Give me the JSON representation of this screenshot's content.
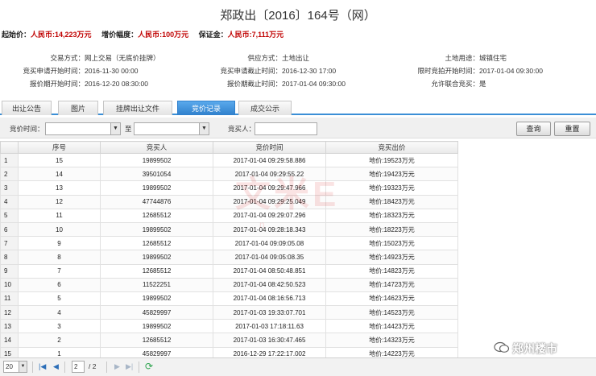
{
  "title": "郑政出〔2016〕164号（网）",
  "summary": [
    {
      "label": "起始价：",
      "value": "人民币:14,223万元"
    },
    {
      "label": "增价幅度：",
      "value": "人民币:100万元"
    },
    {
      "label": "保证金：",
      "value": "人民币:7,111万元"
    }
  ],
  "info": {
    "trade_mode_label": "交易方式：",
    "trade_mode": "网上交易（无底价挂牌）",
    "supply_label": "供应方式：",
    "supply": "土地出让",
    "land_use_label": "土地用途：",
    "land_use": "城镇住宅",
    "apply_start_label": "竞买申请开始时间：",
    "apply_start": "2016-11-30 00:00",
    "apply_end_label": "竞买申请截止时间：",
    "apply_end": "2016-12-30 17:00",
    "timed_start_label": "限时竞拍开始时间：",
    "timed_start": "2017-01-04 09:30:00",
    "quote_start_label": "报价期开始时间：",
    "quote_start": "2016-12-20 08:30:00",
    "quote_end_label": "报价期截止时间：",
    "quote_end": "2017-01-04 09:30:00",
    "joint_label": "允许联合竞买：",
    "joint": "是"
  },
  "tabs": [
    "出让公告",
    "图片",
    "挂牌出让文件",
    "竞价记录",
    "成交公示"
  ],
  "active_tab": 3,
  "filter": {
    "time_label": "竞价时间：",
    "to_label": "至",
    "bidder_label": "竞买人：",
    "query_button": "查询",
    "reset_button": "重置"
  },
  "table": {
    "headers": [
      "序号",
      "竞买人",
      "竞价时间",
      "竞买出价"
    ],
    "rows": [
      [
        "1",
        "15",
        "19899502",
        "2017-01-04 09:29:58.886",
        "地价:19523万元"
      ],
      [
        "2",
        "14",
        "39501054",
        "2017-01-04 09:29:55.22",
        "地价:19423万元"
      ],
      [
        "3",
        "13",
        "19899502",
        "2017-01-04 09:29:47.966",
        "地价:19323万元"
      ],
      [
        "4",
        "12",
        "47744876",
        "2017-01-04 09:29:25.049",
        "地价:18423万元"
      ],
      [
        "5",
        "11",
        "12685512",
        "2017-01-04 09:29:07.296",
        "地价:18323万元"
      ],
      [
        "6",
        "10",
        "19899502",
        "2017-01-04 09:28:18.343",
        "地价:18223万元"
      ],
      [
        "7",
        "9",
        "12685512",
        "2017-01-04 09:09:05.08",
        "地价:15023万元"
      ],
      [
        "8",
        "8",
        "19899502",
        "2017-01-04 09:05:08.35",
        "地价:14923万元"
      ],
      [
        "9",
        "7",
        "12685512",
        "2017-01-04 08:50:48.851",
        "地价:14823万元"
      ],
      [
        "10",
        "6",
        "11522251",
        "2017-01-04 08:42:50.523",
        "地价:14723万元"
      ],
      [
        "11",
        "5",
        "19899502",
        "2017-01-04 08:16:56.713",
        "地价:14623万元"
      ],
      [
        "12",
        "4",
        "45829997",
        "2017-01-03 19:33:07.701",
        "地价:14523万元"
      ],
      [
        "13",
        "3",
        "19899502",
        "2017-01-03 17:18:11.63",
        "地价:14423万元"
      ],
      [
        "14",
        "2",
        "12685512",
        "2017-01-03 16:30:47.465",
        "地价:14323万元"
      ],
      [
        "15",
        "1",
        "45829997",
        "2016-12-29 17:22:17.002",
        "地价:14223万元"
      ]
    ]
  },
  "pager": {
    "page_size": "20",
    "current_page": "2",
    "total_pages": "/ 2"
  },
  "brand": "郑州楼市"
}
